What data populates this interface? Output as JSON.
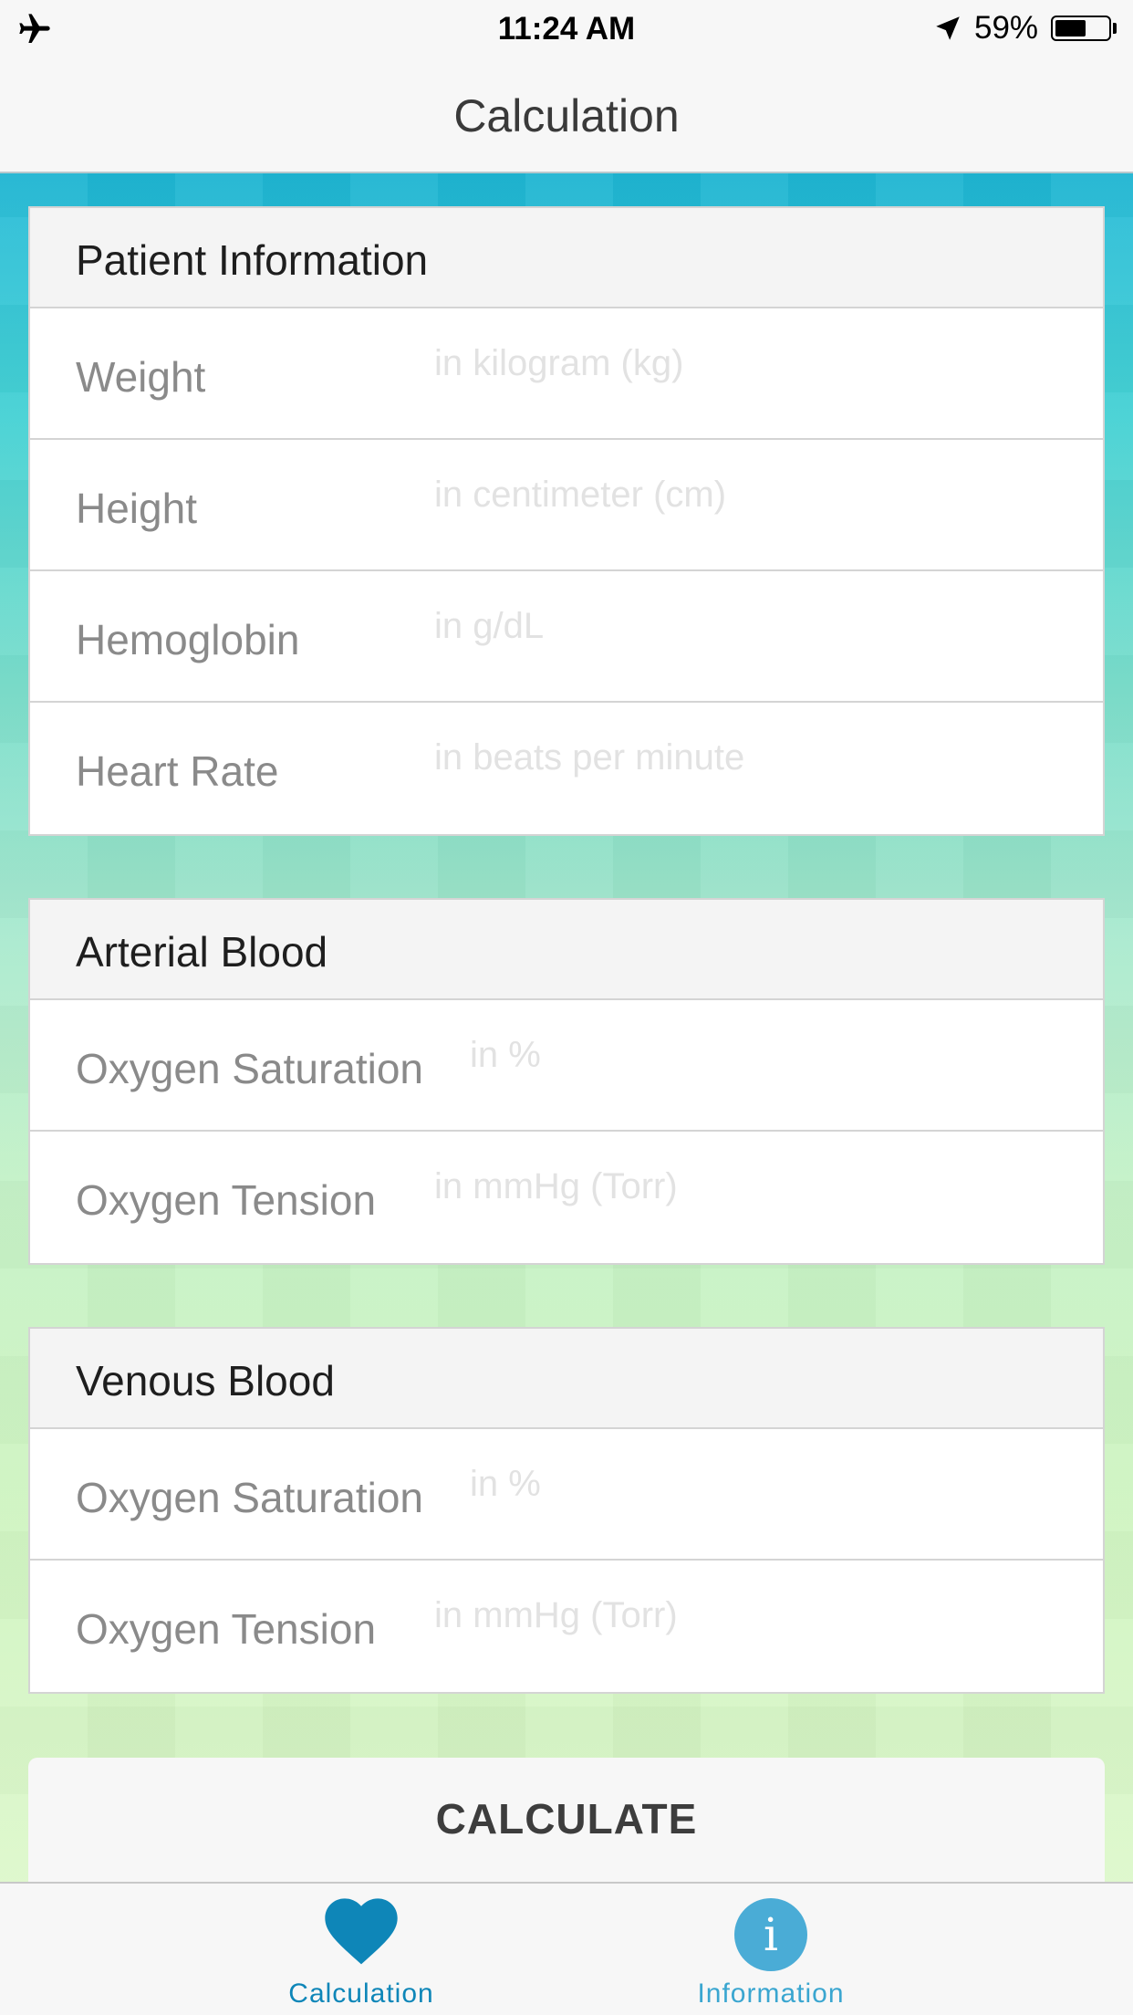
{
  "status_bar": {
    "time": "11:24 AM",
    "battery_percent_label": "59%",
    "battery_level": 0.59,
    "airplane_icon": "airplane-icon",
    "location_icon": "location-arrow-icon"
  },
  "nav": {
    "title": "Calculation"
  },
  "sections": {
    "patient": {
      "title": "Patient Information",
      "rows": [
        {
          "label": "Weight",
          "placeholder": "in kilogram (kg)",
          "value": ""
        },
        {
          "label": "Height",
          "placeholder": "in centimeter (cm)",
          "value": ""
        },
        {
          "label": "Hemoglobin",
          "placeholder": "in g/dL",
          "value": ""
        },
        {
          "label": "Heart Rate",
          "placeholder": "in beats per minute",
          "value": ""
        }
      ]
    },
    "arterial": {
      "title": "Arterial Blood",
      "rows": [
        {
          "label": "Oxygen Saturation",
          "placeholder": "in %",
          "value": ""
        },
        {
          "label": "Oxygen Tension",
          "placeholder": "in mmHg (Torr)",
          "value": ""
        }
      ]
    },
    "venous": {
      "title": "Venous Blood",
      "rows": [
        {
          "label": "Oxygen Saturation",
          "placeholder": "in %",
          "value": ""
        },
        {
          "label": "Oxygen Tension",
          "placeholder": "in mmHg (Torr)",
          "value": ""
        }
      ]
    }
  },
  "calculate_button": {
    "label": "CALCULATE"
  },
  "tab_bar": {
    "tabs": [
      {
        "label": "Calculation",
        "icon": "heart-icon",
        "selected": true
      },
      {
        "label": "Information",
        "icon": "info-icon",
        "selected": false
      }
    ],
    "info_glyph": "i"
  },
  "colors": {
    "accent": "#0e86b8",
    "info_icon": "#4aacd6",
    "gradient_top": "#1fb8d6",
    "gradient_bottom": "#dcf8c9"
  }
}
